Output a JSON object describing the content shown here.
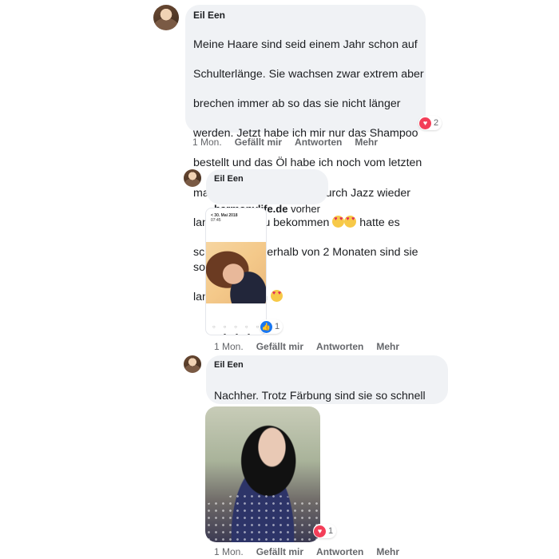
{
  "comments": [
    {
      "author": "Eil Een",
      "text_lines": [
        "Meine Haare sind seid einem Jahr schon auf",
        "Schulterlänge. Sie wachsen zwar extrem aber",
        "brechen immer ab so das sie nicht länger",
        "werden. Jetzt habe ich mir nur das Shampoo",
        "bestellt und das Öl habe ich noch vom letzten",
        "mal. Ich freu mich schon durch Jazz wieder",
        "lange Haare zu bekommen",
        "hatte es",
        "schon mal. Innerhalb von 2 Monaten sind sie so",
        "lang geworden"
      ],
      "reaction_count": "2",
      "time": "1 Mon.",
      "like_label": "Gefällt mir",
      "reply_label": "Antworten",
      "more_label": "Mehr"
    },
    {
      "author": "Eil Een",
      "link_text": "harmonylife.de",
      "text_after_link": " vorher",
      "screenshot_header": "< 30. Mai 2018",
      "screenshot_subheader": "07:45",
      "reaction_count": "1",
      "time": "1 Mon.",
      "like_label": "Gefällt mir",
      "reply_label": "Antworten",
      "more_label": "Mehr"
    },
    {
      "author": "Eil Een",
      "text_lines": [
        "Nachher. Trotz Färbung sind sie so schnell",
        "gewachsen"
      ],
      "reaction_count": "1",
      "time": "1 Mon.",
      "like_label": "Gefällt mir",
      "reply_label": "Antworten",
      "more_label": "Mehr"
    }
  ],
  "colors": {
    "bubble": "#f0f2f5",
    "love": "#f33e58",
    "like": "#1877f2",
    "meta_text": "#65676b"
  },
  "icons": {
    "love_reaction": "heart-reaction-icon",
    "like_reaction": "thumbs-up-reaction-icon",
    "emoji": "heart-eyes-emoji-icon"
  }
}
